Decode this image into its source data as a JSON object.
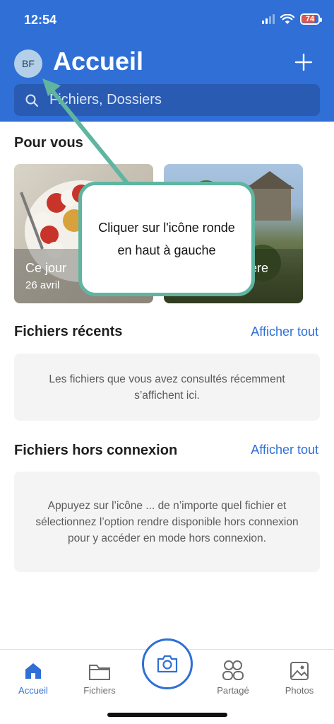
{
  "status": {
    "time": "12:54",
    "battery": "74"
  },
  "header": {
    "avatar_initials": "BF",
    "title": "Accueil",
    "search_placeholder": "Fichiers, Dossiers"
  },
  "for_you": {
    "title": "Pour vous",
    "cards": [
      {
        "label": "Ce jour",
        "date": "26 avril"
      },
      {
        "label": "ière"
      }
    ]
  },
  "recent": {
    "title": "Fichiers récents",
    "link": "Afficher tout",
    "empty_text": "Les fichiers que vous avez consultés récemment s’affichent ici."
  },
  "offline": {
    "title": "Fichiers hors connexion",
    "link": "Afficher tout",
    "empty_text": "Appuyez sur l’icône ... de n’importe quel fichier et sélectionnez l’option rendre disponible hors connexion pour y accéder en mode hors connexion."
  },
  "callout": {
    "text": "Cliquer sur l'icône ronde en haut à gauche"
  },
  "tabbar": {
    "items": [
      {
        "label": "Accueil",
        "icon": "home-icon",
        "active": true
      },
      {
        "label": "Fichiers",
        "icon": "folder-icon",
        "active": false
      },
      {
        "label": "",
        "icon": "camera-icon",
        "active": false
      },
      {
        "label": "Partagé",
        "icon": "shared-icon",
        "active": false
      },
      {
        "label": "Photos",
        "icon": "photos-icon",
        "active": false
      }
    ]
  },
  "colors": {
    "brand": "#2f6fd6",
    "callout_border": "#5fb5a0"
  }
}
